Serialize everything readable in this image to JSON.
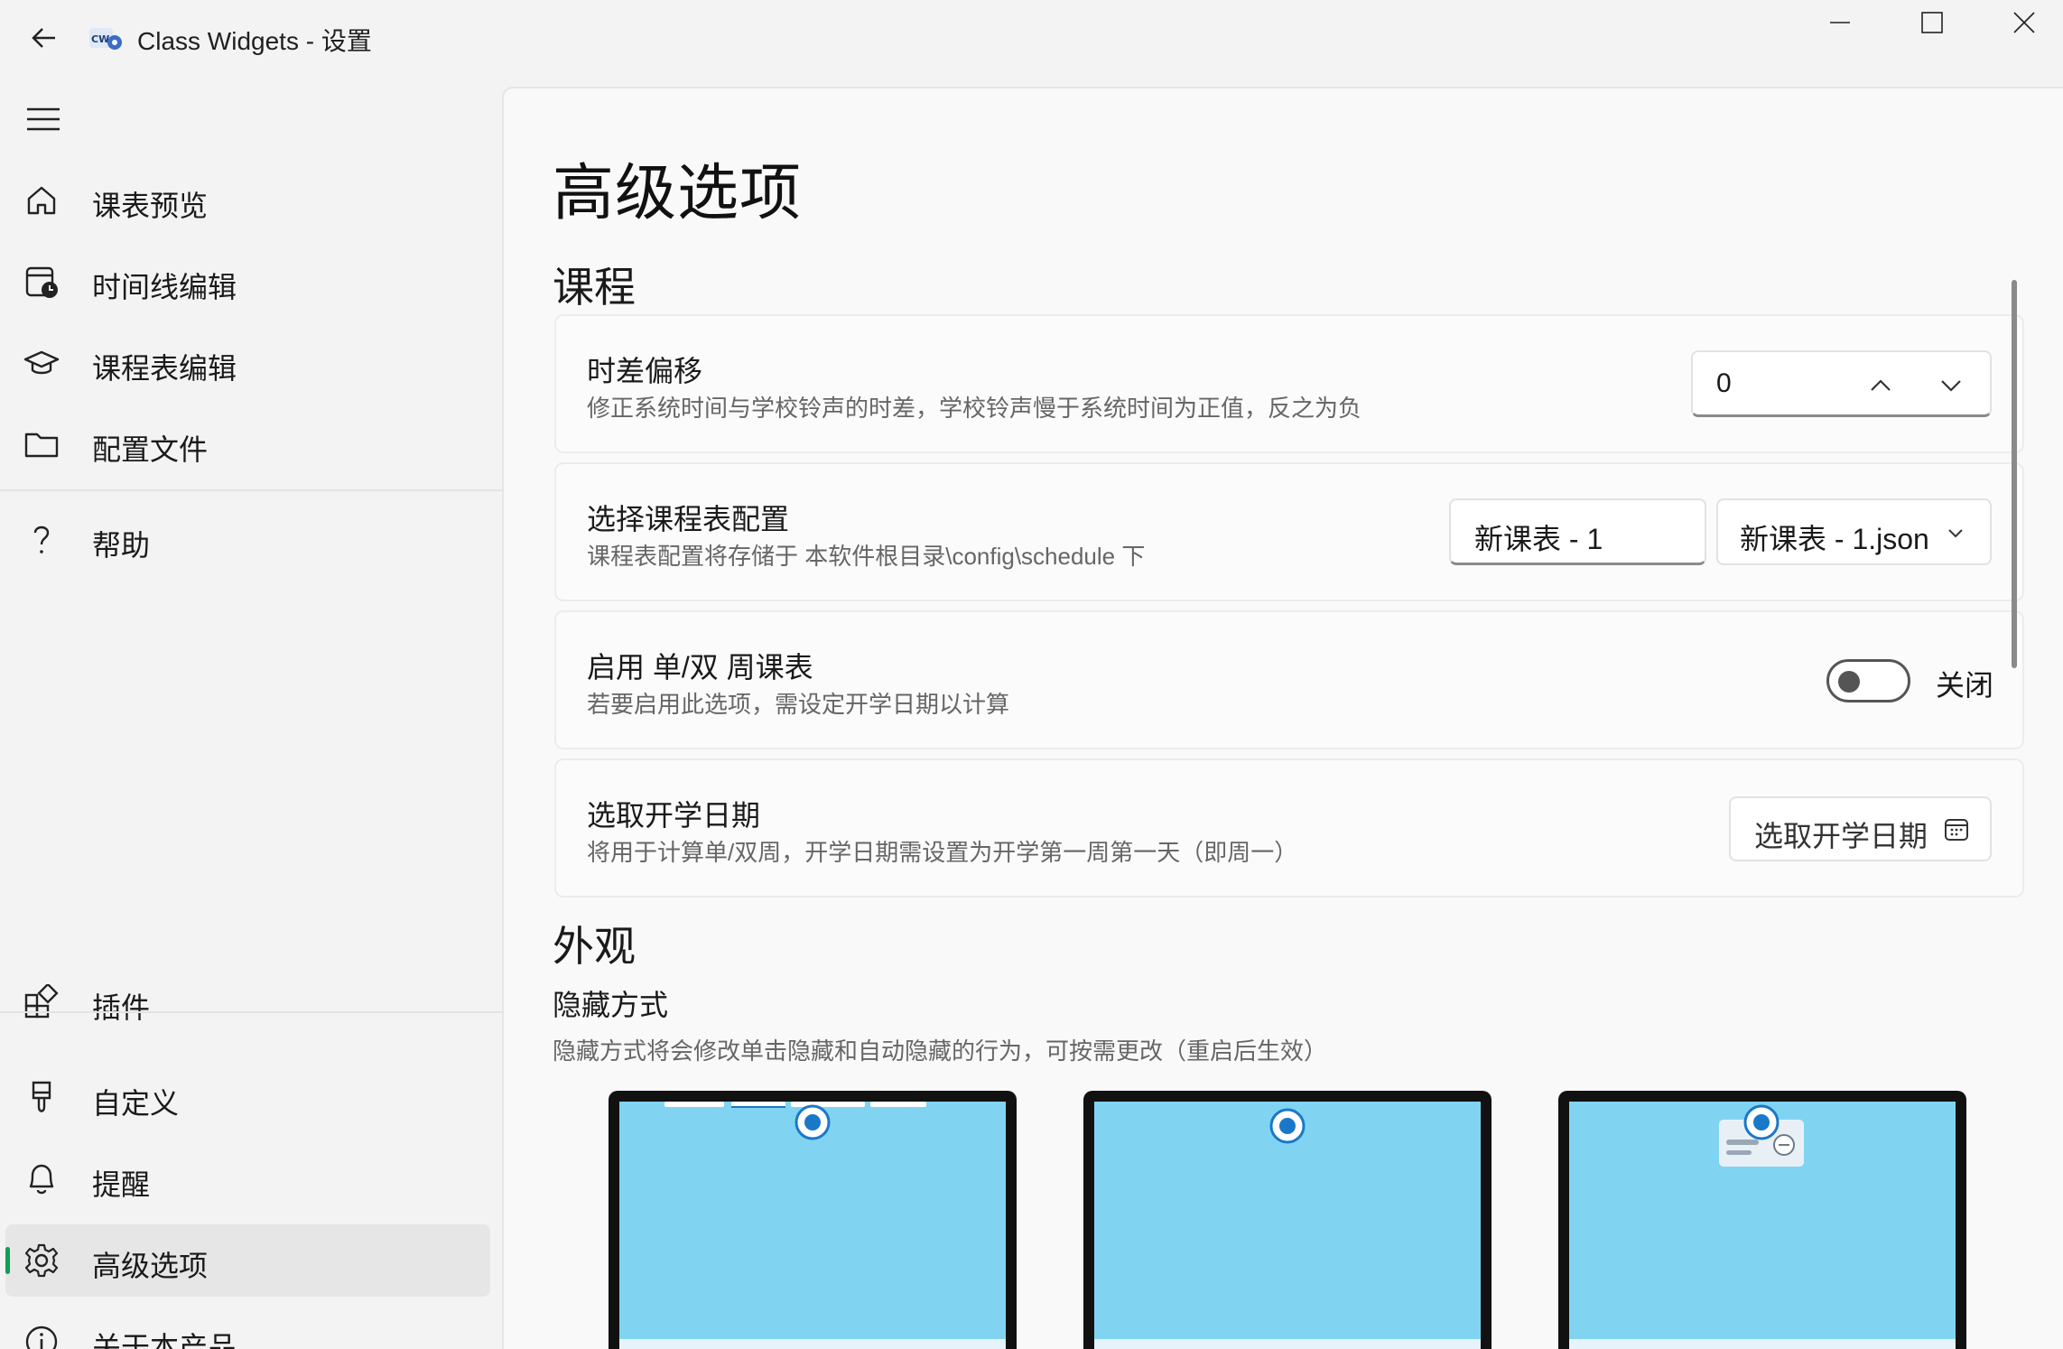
{
  "window": {
    "title": "Class Widgets - 设置",
    "icon": "cw-app-icon"
  },
  "sidebar": {
    "items": [
      {
        "label": "课表预览",
        "icon": "home-icon"
      },
      {
        "label": "时间线编辑",
        "icon": "calendar-clock-icon"
      },
      {
        "label": "课程表编辑",
        "icon": "graduation-cap-icon"
      },
      {
        "label": "配置文件",
        "icon": "folder-icon"
      },
      {
        "label": "帮助",
        "icon": "question-icon"
      },
      {
        "label": "插件",
        "icon": "puzzle-icon"
      },
      {
        "label": "自定义",
        "icon": "paintbrush-icon"
      },
      {
        "label": "提醒",
        "icon": "bell-icon"
      },
      {
        "label": "高级选项",
        "icon": "gear-icon",
        "active": true
      },
      {
        "label": "关于本产品",
        "icon": "info-icon"
      }
    ]
  },
  "page": {
    "title": "高级选项",
    "sections": {
      "course": "课程",
      "appearance": "外观"
    }
  },
  "cards": {
    "offset": {
      "title": "时差偏移",
      "desc": "修正系统时间与学校铃声的时差，学校铃声慢于系统时间为正值，反之为负",
      "value": "0"
    },
    "schedule": {
      "title": "选择课程表配置",
      "desc": "课程表配置将存储于 本软件根目录\\config\\schedule 下",
      "name_value": "新课表 - 1",
      "file_value": "新课表 - 1.json"
    },
    "weekly": {
      "title": "启用 单/双 周课表",
      "desc": "若要启用此选项，需设定开学日期以计算",
      "toggle_label": "关闭",
      "enabled": false
    },
    "start_date": {
      "title": "选取开学日期",
      "desc": "将用于计算单/双周，开学日期需设置为开学第一周第一天（即周一）",
      "button_label": "选取开学日期"
    }
  },
  "appearance": {
    "hide_title": "隐藏方式",
    "hide_desc": "隐藏方式将会修改单击隐藏和自动隐藏的行为，可按需更改（重启后生效）"
  },
  "colors": {
    "accent": "#0f9d58",
    "radio": "#1a78c8",
    "preview_screen": "#80d4f2"
  }
}
